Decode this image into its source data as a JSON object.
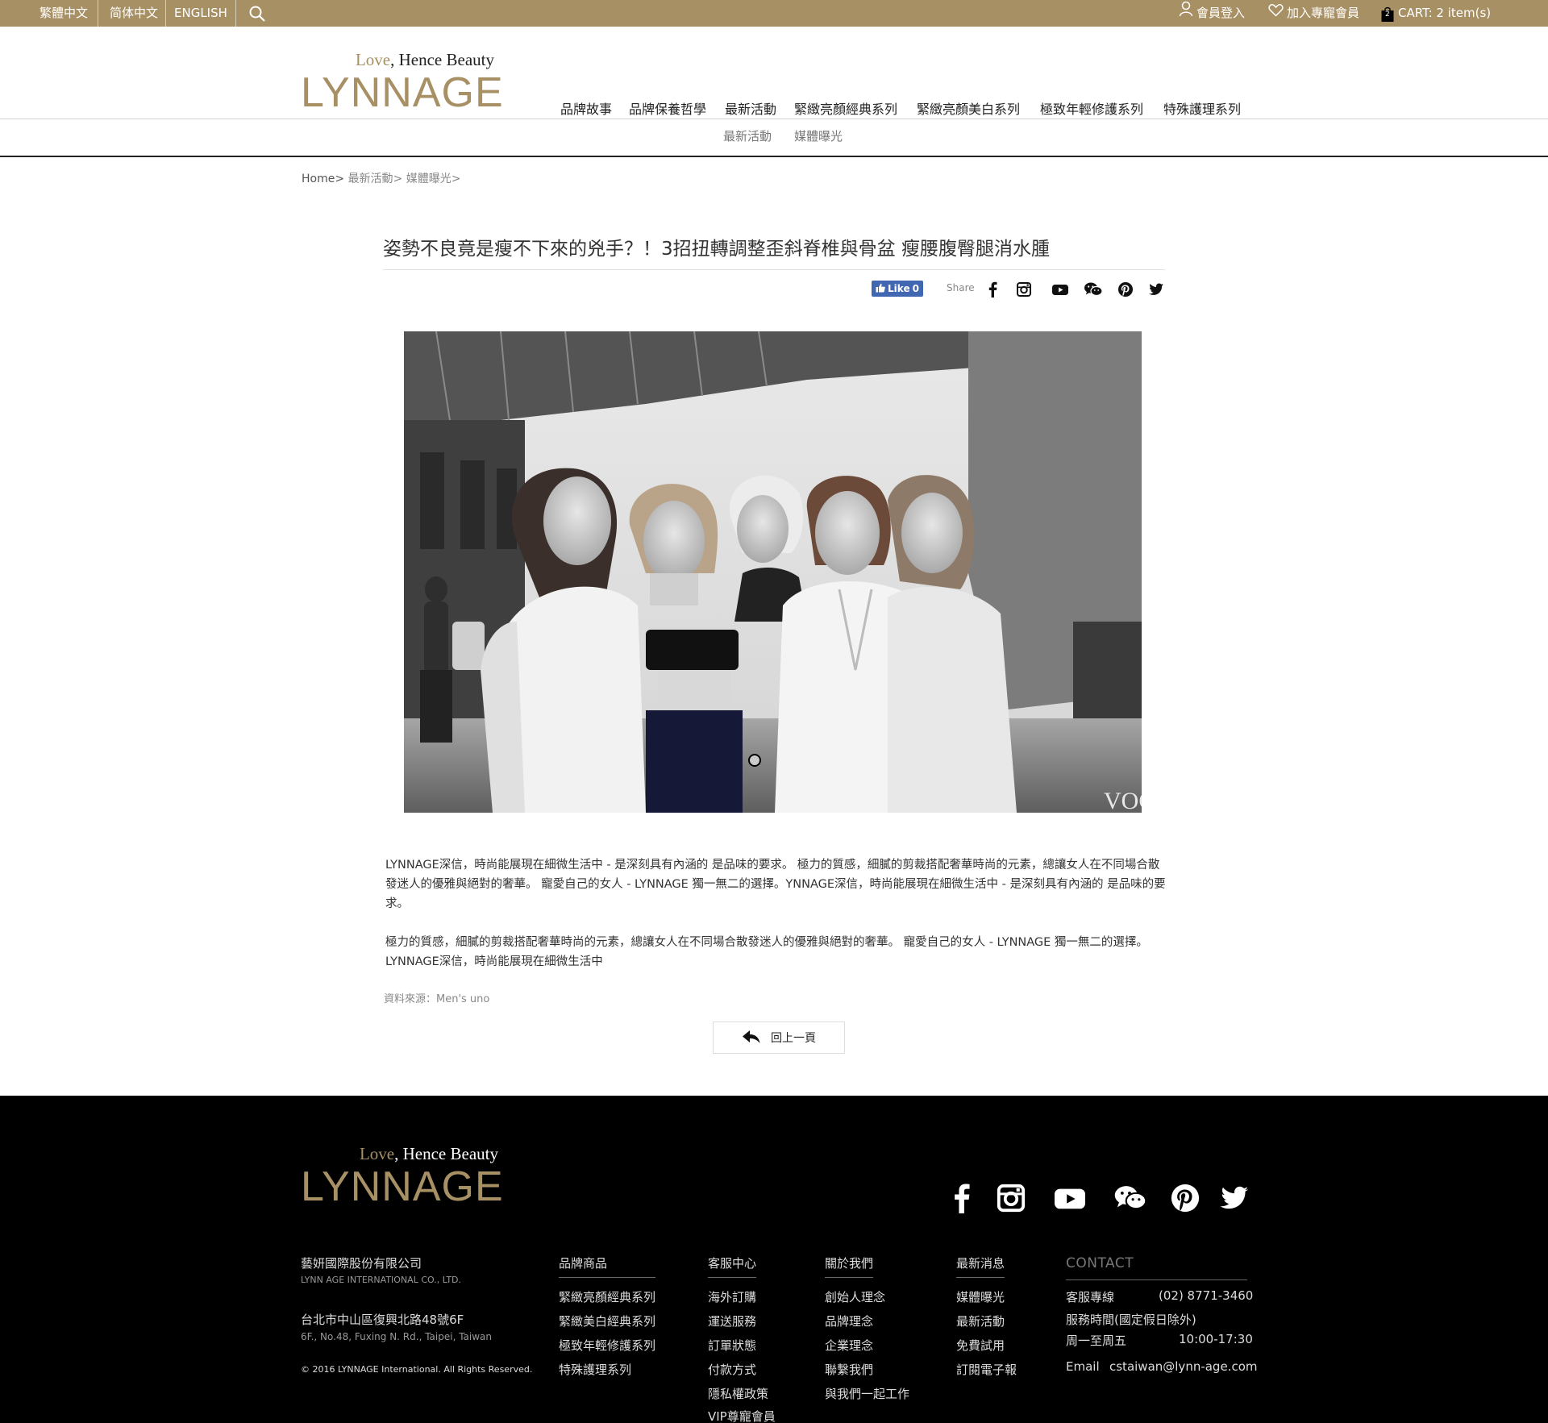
{
  "topbar": {
    "languages": [
      "繁體中文",
      "简体中文",
      "ENGLISH"
    ],
    "member_login": "會員登入",
    "join_vip": "加入專寵會員",
    "cart_count": "2",
    "cart": "CART: 2 item(s)",
    "icons": [
      "search-icon",
      "user-icon",
      "heart-icon",
      "bag-icon"
    ]
  },
  "header": {
    "tagline_love": "Love",
    "tagline_rest": ", Hence Beauty",
    "brand": "LYNNAGE",
    "nav": [
      "品牌故事",
      "品牌保養哲學",
      "最新活動",
      "緊緻亮顏經典系列",
      "緊緻亮顏美白系列",
      "極致年輕修護系列",
      "特殊護理系列"
    ],
    "subnav": [
      "最新活動",
      "媒體曝光"
    ]
  },
  "breadcrumb": {
    "home": "Home>",
    "items": [
      "最新活動>",
      "媒體曝光>"
    ]
  },
  "article": {
    "title": "姿勢不良竟是瘦不下來的兇手？！3招扭轉調整歪斜脊椎與骨盆 瘦腰腹臀腿消水腫",
    "like_label": "Like",
    "like_count": "0",
    "share_label": "Share",
    "share_icons": [
      "facebook-icon",
      "instagram-icon",
      "youtube-icon",
      "wechat-icon",
      "pinterest-icon",
      "twitter-icon"
    ],
    "photo_watermark": "VOG",
    "paragraph1": "LYNNAGE深信，時尚能展現在細微生活中 - 是深刻具有內涵的 是品味的要求。 極力的質感，細膩的剪裁搭配奢華時尚的元素，總讓女人在不同場合散發迷人的優雅與絕對的奢華。 寵愛自己的女人 - LYNNAGE 獨一無二的選擇。YNNAGE深信，時尚能展現在細微生活中 - 是深刻具有內涵的 是品味的要求。",
    "paragraph2": "極力的質感，細膩的剪裁搭配奢華時尚的元素，總讓女人在不同場合散發迷人的優雅與絕對的奢華。 寵愛自己的女人 - LYNNAGE 獨一無二的選擇。LYNNAGE深信，時尚能展現在細微生活中",
    "source": "資料來源：Men's uno",
    "back": "回上一頁"
  },
  "footer": {
    "tagline_love": "Love",
    "tagline_rest": ", Hence Beauty",
    "brand": "LYNNAGE",
    "company_cn": "藝妍國際股份有限公司",
    "company_en": "LYNN AGE INTERNATIONAL CO., LTD.",
    "address_cn": "台北市中山區復興北路48號6F",
    "address_en": "6F., No.48, Fuxing N. Rd., Taipei, Taiwan",
    "copyright": "© 2016 LYNNAGE International. All Rights Reserved.",
    "columns": [
      {
        "title": "品牌商品",
        "links": [
          "緊緻亮顏經典系列",
          "緊緻美白經典系列",
          "極致年輕修護系列",
          "特殊護理系列"
        ]
      },
      {
        "title": "客服中心",
        "links": [
          "海外訂購",
          "運送服務",
          "訂單狀態",
          "付款方式",
          "隱私權政策",
          "VIP尊寵會員"
        ]
      },
      {
        "title": "關於我們",
        "links": [
          "創始人理念",
          "品牌理念",
          "企業理念",
          "聯繫我們",
          "與我們一起工作"
        ]
      },
      {
        "title": "最新消息",
        "links": [
          "媒體曝光",
          "最新活動",
          "免費試用",
          "訂閱電子報"
        ]
      }
    ],
    "contact": {
      "title": "CONTACT",
      "hotline_label": "客服專線",
      "hotline": "(02) 8771-3460",
      "hours_label": "服務時間(國定假日除外)",
      "days": "周一至周五",
      "hours": "10:00-17:30",
      "email_label": "Email",
      "email": "cstaiwan@lynn-age.com"
    },
    "social_icons": [
      "facebook-icon",
      "instagram-icon",
      "youtube-icon",
      "wechat-icon",
      "pinterest-icon",
      "twitter-icon"
    ]
  },
  "colors": {
    "gold": "#a89065",
    "footer_bg": "#000000",
    "facebook_blue": "#4267b2"
  }
}
